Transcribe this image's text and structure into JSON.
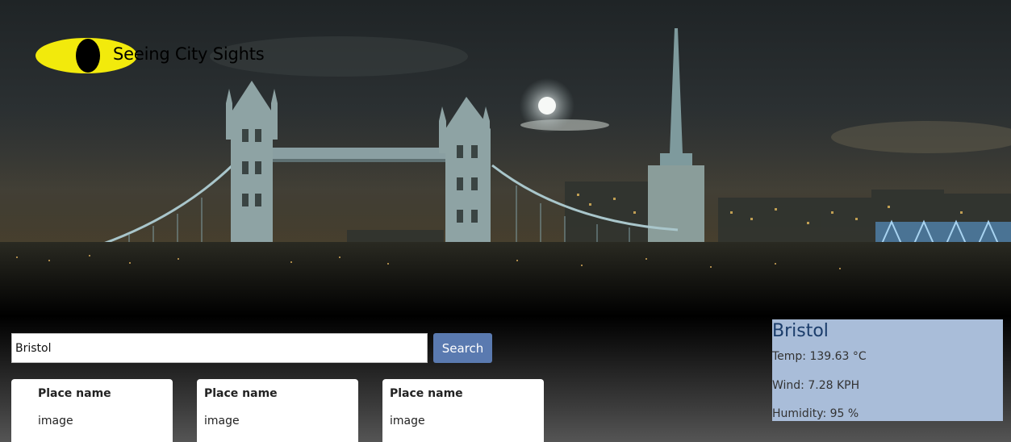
{
  "brand": {
    "name": "Seeing City Sights",
    "logo_colors": {
      "eye": "#f2ea0c",
      "pupil": "#000000"
    }
  },
  "search": {
    "value": "Bristol",
    "button_label": "Search"
  },
  "places": [
    {
      "title": "Place name",
      "image_label": "image"
    },
    {
      "title": "Place name",
      "image_label": "image"
    },
    {
      "title": "Place name",
      "image_label": "image"
    }
  ],
  "weather": {
    "city": "Bristol",
    "temp": "Temp: 139.63 °C",
    "wind": "Wind: 7.28 KPH",
    "humidity": "Humidity: 95 %",
    "panel_color": "#a9bdd9",
    "city_color": "#1b3d6b"
  },
  "colors": {
    "search_button": "#5a7ab0"
  }
}
